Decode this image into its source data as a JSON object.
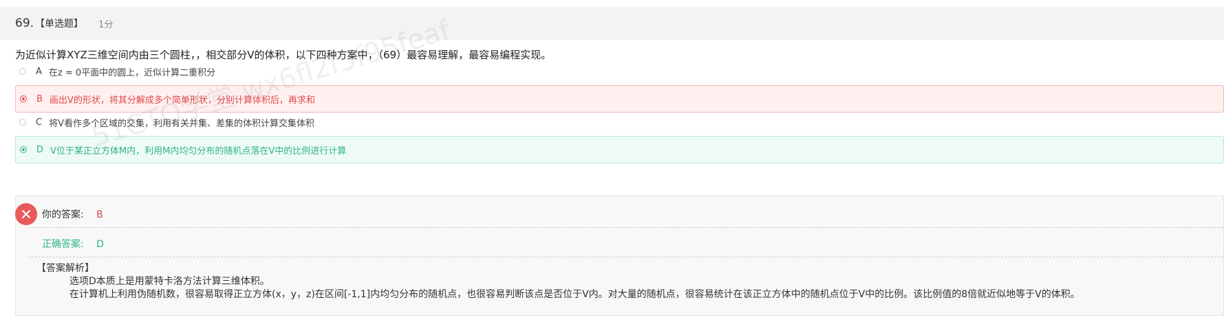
{
  "question": {
    "number": "69.",
    "type": "【单选题】",
    "score": "1分",
    "stem": "为近似计算XYZ三维空间内由三个圆柱，，相交部分V的体积，以下四种方案中，（69）最容易理解，最容易编程实现。"
  },
  "options": [
    {
      "letter": "A",
      "text": "在z = 0平面中的圆上，近似计算二重积分"
    },
    {
      "letter": "B",
      "text": "画出V的形状，将其分解成多个简单形状，分别计算体积后，再求和"
    },
    {
      "letter": "C",
      "text": "将V看作多个区域的交集，利用有关并集、差集的体积计算交集体积"
    },
    {
      "letter": "D",
      "text": "V位于某正立方体M内，利用M内均匀分布的随机点落在V中的比例进行计算"
    }
  ],
  "result": {
    "your_label": "你的答案:",
    "your_value": "B",
    "correct_label": "正确答案:",
    "correct_value": "D"
  },
  "analysis": {
    "heading": "【答案解析】",
    "line1": "选项D本质上是用蒙特卡洛方法计算三维体积。",
    "line2": "在计算机上利用伪随机数，很容易取得正立方体(x，y，z)在区间[-1,1]内均匀分布的随机点，也很容易判断该点是否位于V内。对大量的随机点，很容易统计在该正立方体中的随机点位于V中的比例。该比例值的8倍就近似地等于V的体积。"
  },
  "watermark": "51CTO学堂 wx6fl2f5f95feaf",
  "colors": {
    "wrong": "#e24848",
    "correct": "#2fb38c",
    "header_bg": "#f3f3f3"
  }
}
